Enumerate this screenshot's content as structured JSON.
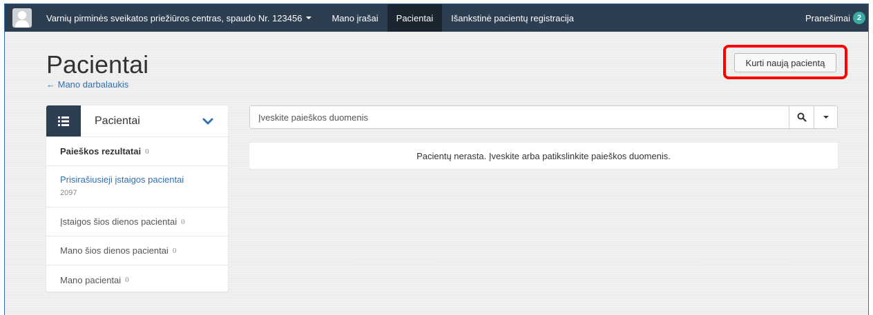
{
  "navbar": {
    "brand": "Varnių pirminės sveikatos priežiūros centras, spaudo Nr. 123456",
    "items": [
      {
        "label": "Mano įrašai",
        "active": false
      },
      {
        "label": "Pacientai",
        "active": true
      },
      {
        "label": "Išankstinė pacientų registracija",
        "active": false
      }
    ],
    "notifications_label": "Pranešimai",
    "notifications_count": "2"
  },
  "header": {
    "title": "Pacientai",
    "back_link": "← Mano darbalaukis",
    "create_button": "Kurti naują pacientą"
  },
  "sidebar": {
    "title": "Pacientai",
    "items": [
      {
        "label": "Paieškos rezultatai",
        "count": "0"
      },
      {
        "label": "Prisirašiusieji įstaigos pacientai",
        "count": "2097"
      },
      {
        "label": "Įstaigos šios dienos pacientai",
        "count": "0"
      },
      {
        "label": "Mano šios dienos pacientai",
        "count": "0"
      },
      {
        "label": "Mano pacientai",
        "count": "0"
      }
    ]
  },
  "search": {
    "placeholder": "Įveskite paieškos duomenis",
    "value": ""
  },
  "results": {
    "message": "Pacientų nerasta. Įveskite arba patikslinkite paieškos duomenis."
  },
  "colors": {
    "navbar_bg": "#2c3e50",
    "navbar_active": "#1a252f",
    "link": "#2f6fb4",
    "badge": "#3aa9a3",
    "highlight": "#ff0000"
  }
}
